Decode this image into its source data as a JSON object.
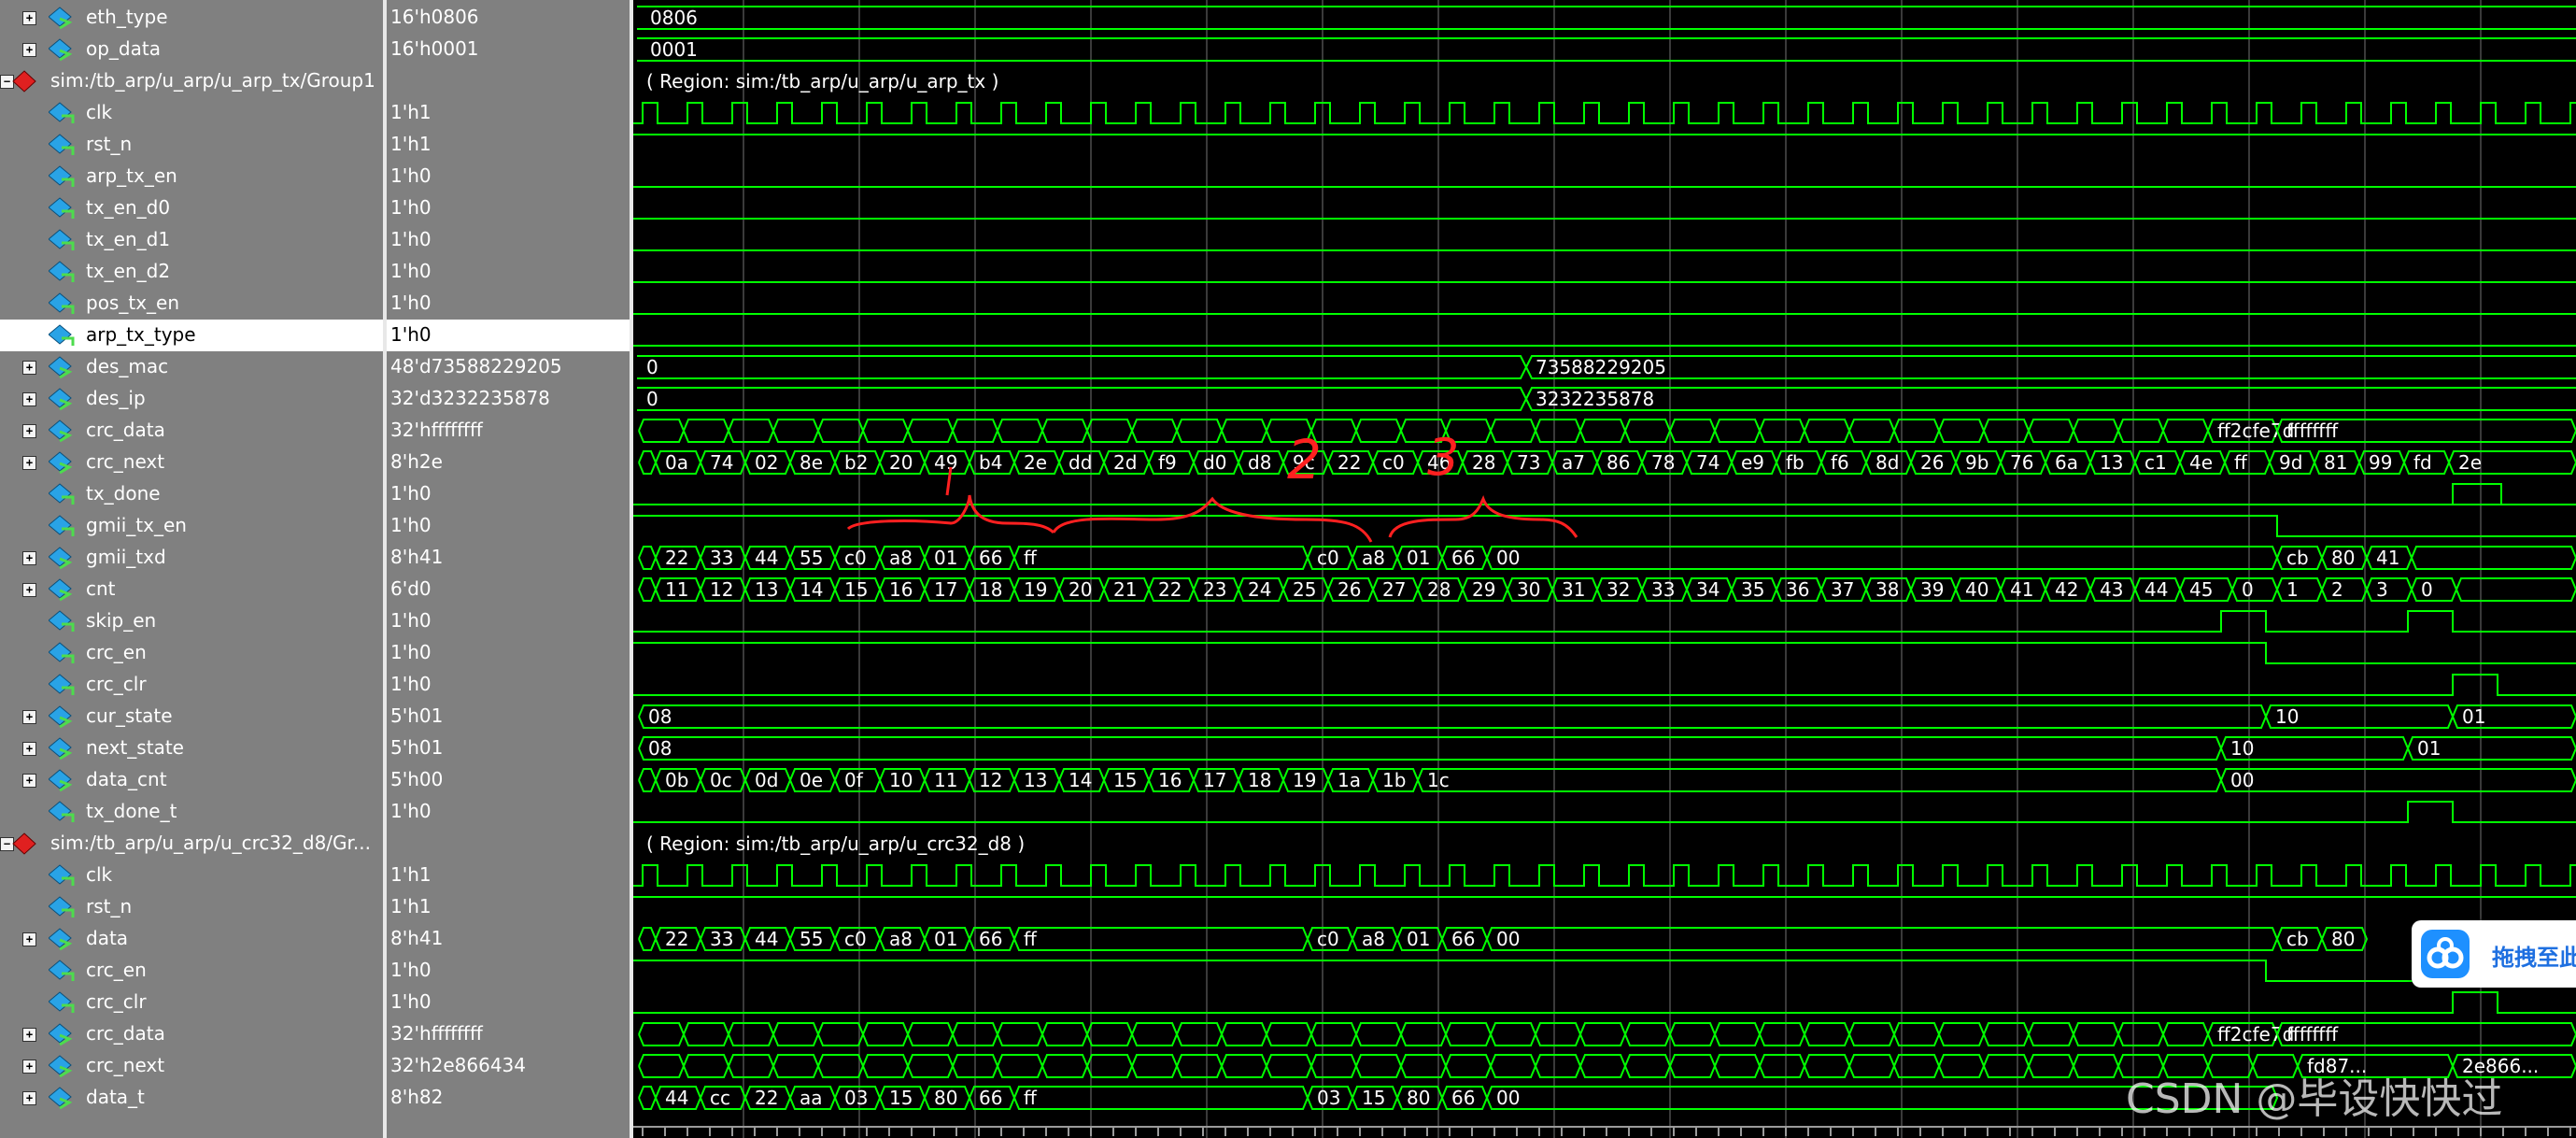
{
  "signals": [
    {
      "name": "eth_type",
      "value": "16'h0806",
      "expandable": true,
      "group": false
    },
    {
      "name": "op_data",
      "value": "16'h0001",
      "expandable": true,
      "group": false
    },
    {
      "name": "sim:/tb_arp/u_arp/u_arp_tx/Group1",
      "value": "",
      "expandable": false,
      "group": true
    },
    {
      "name": "clk",
      "value": "1'h1",
      "expandable": false,
      "group": false
    },
    {
      "name": "rst_n",
      "value": "1'h1",
      "expandable": false,
      "group": false
    },
    {
      "name": "arp_tx_en",
      "value": "1'h0",
      "expandable": false,
      "group": false
    },
    {
      "name": "tx_en_d0",
      "value": "1'h0",
      "expandable": false,
      "group": false
    },
    {
      "name": "tx_en_d1",
      "value": "1'h0",
      "expandable": false,
      "group": false
    },
    {
      "name": "tx_en_d2",
      "value": "1'h0",
      "expandable": false,
      "group": false
    },
    {
      "name": "pos_tx_en",
      "value": "1'h0",
      "expandable": false,
      "group": false
    },
    {
      "name": "arp_tx_type",
      "value": "1'h0",
      "expandable": false,
      "group": false,
      "selected": true
    },
    {
      "name": "des_mac",
      "value": "48'd73588229205",
      "expandable": true,
      "group": false
    },
    {
      "name": "des_ip",
      "value": "32'd3232235878",
      "expandable": true,
      "group": false
    },
    {
      "name": "crc_data",
      "value": "32'hffffffff",
      "expandable": true,
      "group": false
    },
    {
      "name": "crc_next",
      "value": "8'h2e",
      "expandable": true,
      "group": false
    },
    {
      "name": "tx_done",
      "value": "1'h0",
      "expandable": false,
      "group": false
    },
    {
      "name": "gmii_tx_en",
      "value": "1'h0",
      "expandable": false,
      "group": false
    },
    {
      "name": "gmii_txd",
      "value": "8'h41",
      "expandable": true,
      "group": false
    },
    {
      "name": "cnt",
      "value": "6'd0",
      "expandable": true,
      "group": false
    },
    {
      "name": "skip_en",
      "value": "1'h0",
      "expandable": false,
      "group": false
    },
    {
      "name": "crc_en",
      "value": "1'h0",
      "expandable": false,
      "group": false
    },
    {
      "name": "crc_clr",
      "value": "1'h0",
      "expandable": false,
      "group": false
    },
    {
      "name": "cur_state",
      "value": "5'h01",
      "expandable": true,
      "group": false
    },
    {
      "name": "next_state",
      "value": "5'h01",
      "expandable": true,
      "group": false
    },
    {
      "name": "data_cnt",
      "value": "5'h00",
      "expandable": true,
      "group": false
    },
    {
      "name": "tx_done_t",
      "value": "1'h0",
      "expandable": false,
      "group": false
    },
    {
      "name": "sim:/tb_arp/u_arp/u_crc32_d8/Gr...",
      "value": "",
      "expandable": false,
      "group": true
    },
    {
      "name": "clk",
      "value": "1'h1",
      "expandable": false,
      "group": false
    },
    {
      "name": "rst_n",
      "value": "1'h1",
      "expandable": false,
      "group": false
    },
    {
      "name": "data",
      "value": "8'h41",
      "expandable": true,
      "group": false
    },
    {
      "name": "crc_en",
      "value": "1'h0",
      "expandable": false,
      "group": false
    },
    {
      "name": "crc_clr",
      "value": "1'h0",
      "expandable": false,
      "group": false
    },
    {
      "name": "crc_data",
      "value": "32'hffffffff",
      "expandable": true,
      "group": false
    },
    {
      "name": "crc_next",
      "value": "32'h2e866434",
      "expandable": true,
      "group": false
    },
    {
      "name": "data_t",
      "value": "8'h82",
      "expandable": true,
      "group": false
    }
  ],
  "bus_labels": {
    "eth_type": [
      "0806"
    ],
    "op_data": [
      "0001"
    ],
    "group1_region": "( Region: sim:/tb_arp/u_arp/u_arp_tx )",
    "des_mac": [
      "0",
      "73588229205"
    ],
    "des_ip": [
      "0",
      "3232235878"
    ],
    "crc_data": [
      "ff2cfe7d",
      "ffffffff"
    ],
    "crc_next": [
      "0a",
      "74",
      "02",
      "8e",
      "b2",
      "20",
      "49",
      "b4",
      "2e",
      "dd",
      "2d",
      "f9",
      "d0",
      "d8",
      "9c",
      "22",
      "c0",
      "46",
      "28",
      "73",
      "a7",
      "86",
      "78",
      "74",
      "e9",
      "fb",
      "f6",
      "8d",
      "26",
      "9b",
      "76",
      "6a",
      "13",
      "c1",
      "4e",
      "ff",
      "9d",
      "81",
      "99",
      "fd",
      "2e"
    ],
    "gmii_txd": [
      "22",
      "33",
      "44",
      "55",
      "c0",
      "a8",
      "01",
      "66",
      "ff",
      "c0",
      "a8",
      "01",
      "66",
      "00",
      "cb",
      "80",
      "41"
    ],
    "cnt": [
      "11",
      "12",
      "13",
      "14",
      "15",
      "16",
      "17",
      "18",
      "19",
      "20",
      "21",
      "22",
      "23",
      "24",
      "25",
      "26",
      "27",
      "28",
      "29",
      "30",
      "31",
      "32",
      "33",
      "34",
      "35",
      "36",
      "37",
      "38",
      "39",
      "40",
      "41",
      "42",
      "43",
      "44",
      "45",
      "0",
      "1",
      "2",
      "3",
      "0"
    ],
    "cur_state": [
      "08",
      "10",
      "01"
    ],
    "next_state": [
      "08",
      "10",
      "01"
    ],
    "data_cnt": [
      "0b",
      "0c",
      "0d",
      "0e",
      "0f",
      "10",
      "11",
      "12",
      "13",
      "14",
      "15",
      "16",
      "17",
      "18",
      "19",
      "1a",
      "1b",
      "1c",
      "00"
    ],
    "group2_region": "( Region: sim:/tb_arp/u_arp/u_crc32_d8 )",
    "data": [
      "22",
      "33",
      "44",
      "55",
      "c0",
      "a8",
      "01",
      "66",
      "ff",
      "c0",
      "a8",
      "01",
      "66",
      "00",
      "cb",
      "80"
    ],
    "crc32_crc_data": [
      "ff2cfe7d",
      "ffffffff"
    ],
    "crc32_crc_next": [
      "fd87...",
      "2e866..."
    ],
    "data_t": [
      "44",
      "cc",
      "22",
      "aa",
      "03",
      "15",
      "80",
      "66",
      "ff",
      "03",
      "15",
      "80",
      "66",
      "00"
    ]
  },
  "annotations": [
    "2",
    "3"
  ],
  "baidu_button": "拖拽至此",
  "watermark": "CSDN @毕设快快过",
  "colors": {
    "wave": "#00ff00",
    "bus": "#00ff00",
    "text": "#ffffff",
    "annotation": "#ff2020",
    "grid": "#3a3a3a",
    "bg": "#000000",
    "panel": "#808080",
    "selected": "#ffffff"
  }
}
